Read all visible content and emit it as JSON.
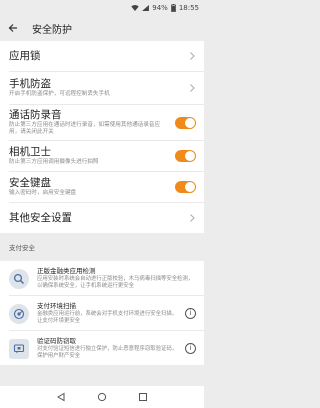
{
  "status_bar": {
    "battery": "94%",
    "time": "18:55"
  },
  "header": {
    "title": "安全防护"
  },
  "settings": {
    "app_lock": {
      "label": "应用锁"
    },
    "phone_anti_theft": {
      "label": "手机防盗",
      "desc": "开启手机防盗保护，可远程控制丢失手机"
    },
    "call_recording": {
      "label": "通话防录音",
      "desc": "防止第三方应用在通话时进行录音，如需使用其他通话录音应用，请关闭此开关",
      "enabled": true
    },
    "camera_guard": {
      "label": "相机卫士",
      "desc": "防止第三方应用调用摄像头进行拍照",
      "enabled": true
    },
    "secure_keyboard": {
      "label": "安全键盘",
      "desc": "输入密码时，启用安全键盘",
      "enabled": true
    },
    "other_settings": {
      "label": "其他安全设置"
    }
  },
  "payment_section": {
    "title": "支付安全",
    "items": [
      {
        "title": "正版金融类应用检测",
        "desc": "应用安装时系统会自动进行正版校验，木马病毒扫描等安全检测，以确保系统安全，让手机系统运行更安全",
        "icon": "search-shield-icon"
      },
      {
        "title": "支付环境扫描",
        "desc": "金融类应用运行前，系统会对手机支付环境进行安全扫描，让支付环境更安全",
        "icon": "scan-icon"
      },
      {
        "title": "验证码防窃取",
        "desc": "对支付验证短信进行独立保护，防止恶意程序窃取验证码，保护用户财产安全",
        "icon": "message-lock-icon"
      }
    ]
  },
  "colors": {
    "accent": "#f08a1a",
    "background": "#ececec",
    "card": "#ffffff"
  }
}
